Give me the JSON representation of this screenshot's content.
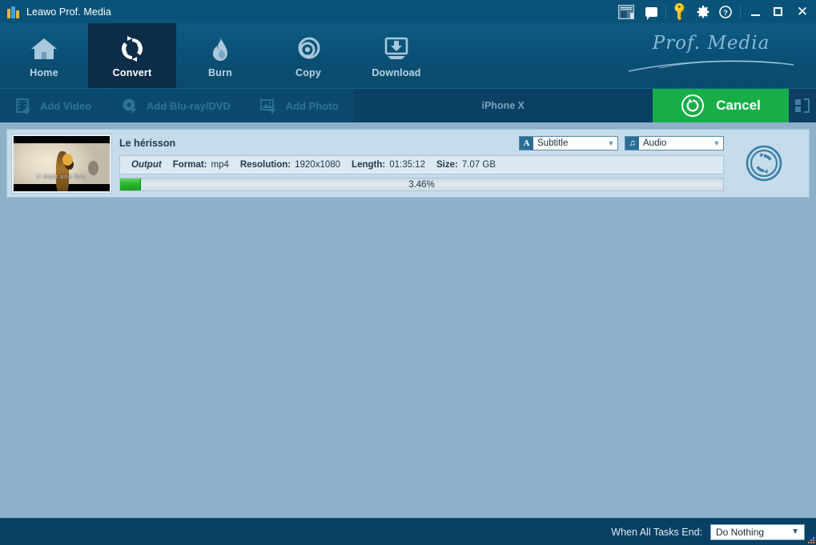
{
  "window": {
    "title": "Leawo Prof. Media",
    "logo_icon": "leawo-logo-icon",
    "controls": {
      "news": "news-icon",
      "feedback": "speech-bubble-icon",
      "register": "key-icon",
      "settings": "gear-icon",
      "help": "help-icon",
      "minimize": "minimize-icon",
      "maximize": "maximize-icon",
      "close": "close-icon"
    }
  },
  "nav": {
    "items": [
      {
        "label": "Home",
        "icon": "home-icon",
        "active": false
      },
      {
        "label": "Convert",
        "icon": "convert-icon",
        "active": true
      },
      {
        "label": "Burn",
        "icon": "flame-icon",
        "active": false
      },
      {
        "label": "Copy",
        "icon": "disc-icon",
        "active": false
      },
      {
        "label": "Download",
        "icon": "download-icon",
        "active": false
      }
    ],
    "brand": "Prof. Media"
  },
  "toolbar": {
    "add_video": "Add Video",
    "add_bluray": "Add Blu-ray/DVD",
    "add_photo": "Add Photo",
    "profile": "iPhone X",
    "cancel": "Cancel",
    "panel_toggle_icon": "panel-layout-icon"
  },
  "task": {
    "title": "Le hérisson",
    "thumbnail_subtitle": "il était une fois",
    "subtitle_select": {
      "label": "Subtitle",
      "badge": "A"
    },
    "audio_select": {
      "label": "Audio",
      "badge": "♫"
    },
    "output": {
      "heading": "Output",
      "format_key": "Format:",
      "format_value": "mp4",
      "resolution_key": "Resolution:",
      "resolution_value": "1920x1080",
      "length_key": "Length:",
      "length_value": "01:35:12",
      "size_key": "Size:",
      "size_value": "7.07 GB"
    },
    "progress": {
      "percent_label": "3.46%",
      "percent": 3.46
    },
    "convert_icon": "convert-circle-icon"
  },
  "status": {
    "when_tasks_end_label": "When All Tasks End:",
    "when_tasks_end_value": "Do Nothing",
    "resize_grip_icon": "resize-grip-icon"
  },
  "colors": {
    "titlebar": "#0a5378",
    "nav": "#0b4f74",
    "nav_active": "#0c2c48",
    "toolbar": "#0c4a6d",
    "accent_green": "#17ae48",
    "main_bg": "#8fb0c9",
    "row_bg": "#c6dcea",
    "progress_green": "#28b428",
    "key_yellow": "#f5c52a"
  }
}
